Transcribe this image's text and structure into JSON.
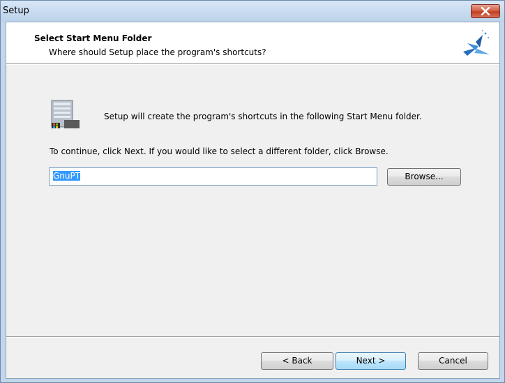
{
  "window": {
    "title": "Setup"
  },
  "header": {
    "title": "Select Start Menu Folder",
    "subtitle": "Where should Setup place the program's shortcuts?",
    "logo_icon": "setup-wizard-icon"
  },
  "body": {
    "icon": "start-menu-folder-icon",
    "intro": "Setup will create the program's shortcuts in the following Start Menu folder.",
    "continue": "To continue, click Next. If you would like to select a different folder, click Browse.",
    "folder_value": "GnuPT",
    "browse_label": "Browse..."
  },
  "footer": {
    "back_label": "< Back",
    "next_label": "Next >",
    "cancel_label": "Cancel"
  },
  "colors": {
    "selection": "#3399ff",
    "close_button": "#c23e22",
    "default_button_border": "#3c7fb1"
  }
}
